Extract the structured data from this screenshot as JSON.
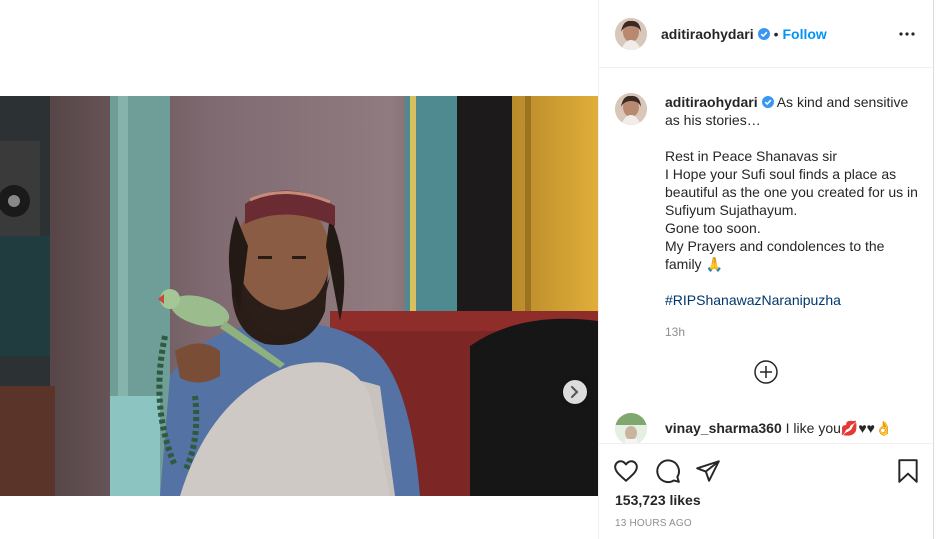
{
  "post": {
    "author": "aditiraohydari",
    "follow_label": "Follow",
    "dot": "•",
    "caption_lines": [
      "As kind and sensitive as his stories…"
    ],
    "caption_first": "As kind and sensitive as his stories…",
    "caption_rest": [
      "Rest in Peace Shanavas sir",
      "I Hope your Sufi soul finds a place as beautiful as the one you created for us in Sufiyum Sujathayum.",
      "Gone too soon.",
      "My Prayers and condolences to the family 🙏"
    ],
    "hashtag": "#RIPShanawazNaranipuzha",
    "caption_age": "13h",
    "comment": {
      "user": "vinay_sharma360",
      "text": "I like you💋♥♥👌"
    },
    "likes": "153,723 likes",
    "posted": "13 HOURS AGO"
  },
  "icons": {
    "verified": "verified-badge-icon",
    "more": "more-options-icon",
    "load_more": "plus-circle-icon",
    "like": "heart-icon",
    "comment": "comment-bubble-icon",
    "share": "paper-plane-icon",
    "save": "bookmark-icon",
    "next": "chevron-right-icon"
  },
  "colors": {
    "accent": "#0095f6",
    "hashtag": "#00376b",
    "muted": "#8e8e8e",
    "text": "#262626"
  }
}
